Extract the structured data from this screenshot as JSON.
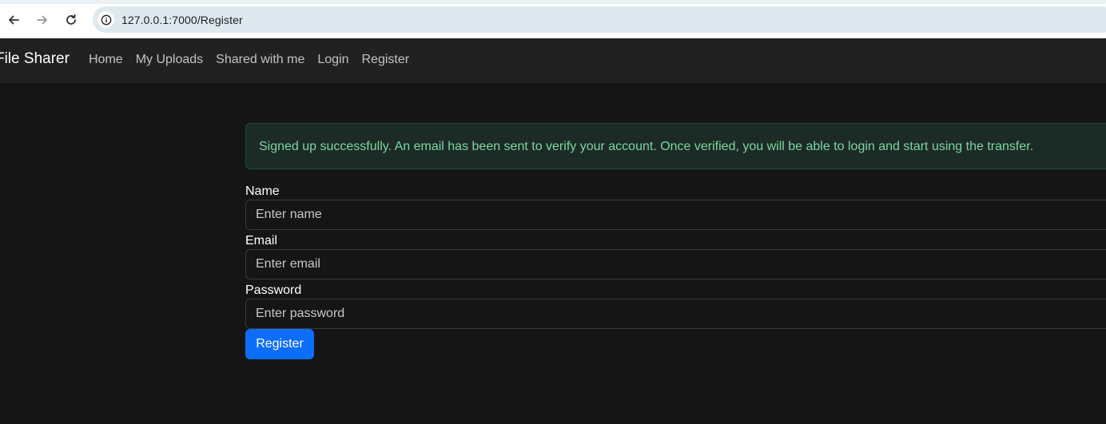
{
  "browser": {
    "url": "127.0.0.1:7000/Register",
    "icons": [
      "back-arrow-icon",
      "forward-arrow-icon",
      "reload-icon",
      "info-icon"
    ]
  },
  "navbar": {
    "brand": "File Sharer",
    "links": [
      "Home",
      "My Uploads",
      "Shared with me",
      "Login",
      "Register"
    ]
  },
  "alert": {
    "message": "Signed up successfully. An email has been sent to verify your account. Once verified, you will be able to login and start using the transfer."
  },
  "form": {
    "name_label": "Name",
    "name_placeholder": "Enter name",
    "email_label": "Email",
    "email_placeholder": "Enter email",
    "password_label": "Password",
    "password_placeholder": "Enter password",
    "submit_label": "Register"
  },
  "colors": {
    "background": "#151515",
    "navbar": "#212121",
    "alert_bg": "#1c2b25",
    "alert_text": "#7bd6a3",
    "primary": "#0d6efd"
  }
}
